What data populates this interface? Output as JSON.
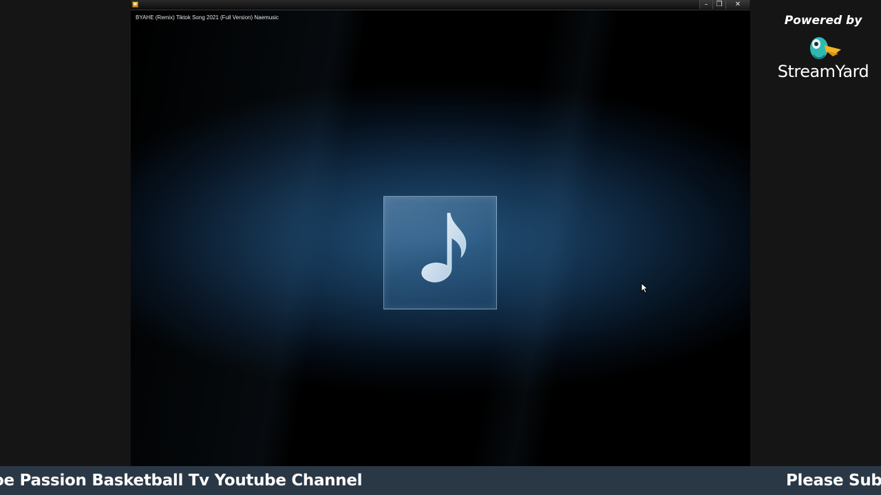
{
  "player": {
    "media_title": "BYAHE (Remix) Tiktok Song 2021 (Full Version) Naemusic",
    "window_controls": {
      "minimize": "–",
      "restore": "❐",
      "close": "✕"
    },
    "app_icon": "media-player-icon",
    "artwork_icon": "music-note-icon"
  },
  "branding": {
    "powered_by": "Powered by",
    "name": "StreamYard",
    "logo_icon": "streamyard-duck-icon"
  },
  "ticker": {
    "text_a": "oe Passion Basketball Tv Youtube Channel",
    "text_b": "Please Subs"
  },
  "colors": {
    "ticker_bg": "#2a3846",
    "artwork_tint": "#4f86b6",
    "background": "#151515"
  }
}
